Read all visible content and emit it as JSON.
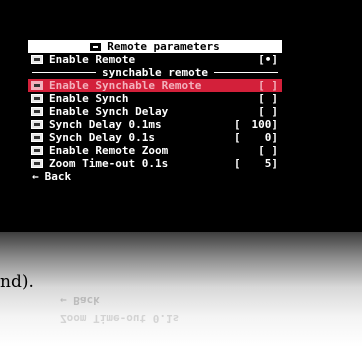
{
  "menu": {
    "title": "Remote parameters",
    "separator_label": "synchable remote",
    "rows": [
      {
        "label": "Enable Remote",
        "value": "[•]"
      },
      {
        "label": "Enable Synchable Remote",
        "value": "[ ]"
      },
      {
        "label": "Enable Synch",
        "value": "[ ]"
      },
      {
        "label": "Enable Synch Delay",
        "value": "[ ]"
      },
      {
        "label": "Synch Delay 0.1ms",
        "lbracket": "[",
        "value": "100]"
      },
      {
        "label": "Synch Delay 0.1s",
        "lbracket": "[",
        "value": "0]"
      },
      {
        "label": "Enable Remote Zoom",
        "value": "[ ]"
      },
      {
        "label": "Zoom Time-out 0.1s",
        "lbracket": "[",
        "value": "5]"
      }
    ],
    "back_label": "Back",
    "back_arrow": "←",
    "selected_row_color": "#d3203a"
  },
  "caption": "nd).",
  "reflection_ghost": {
    "line1": "← Back",
    "line2": "Zoom Time-out 0.1s"
  }
}
